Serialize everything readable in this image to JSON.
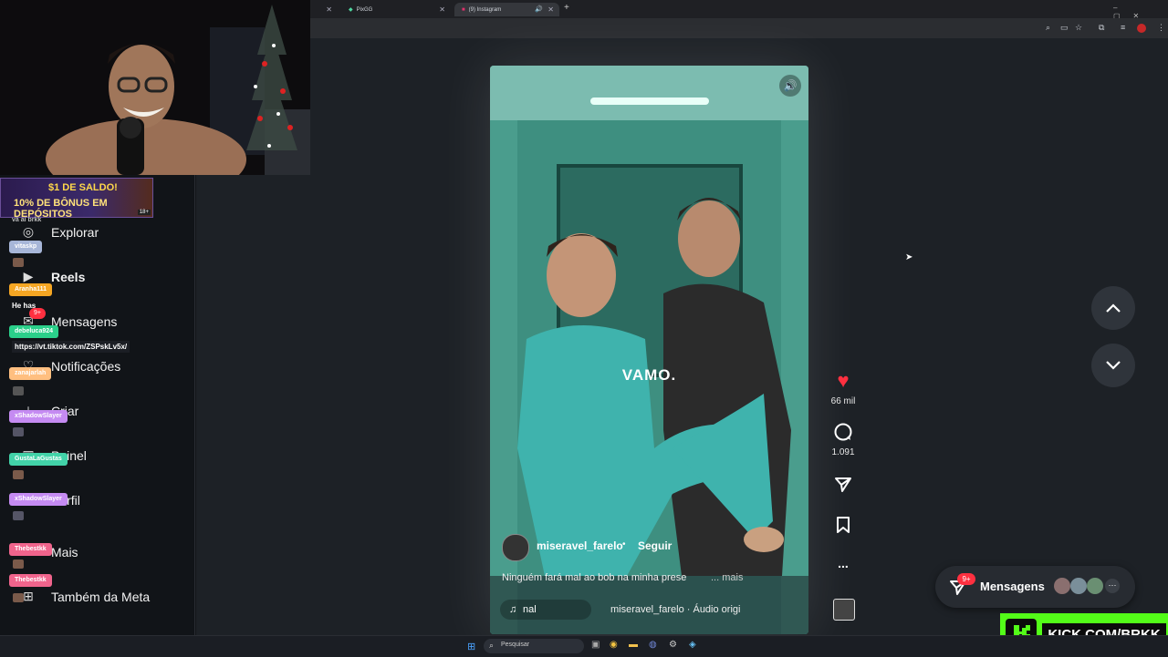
{
  "browser": {
    "tabs": [
      {
        "label": "PixGG"
      },
      {
        "label": "(9) Instagram"
      }
    ],
    "new_tab_symbol": "+"
  },
  "stream_overlay": {
    "banner": {
      "line1": "$1 DE SALDO!",
      "line2": "10% DE BÔNUS EM DEPÓSITOS",
      "badge": "18+"
    },
    "chat": [
      {
        "user": "vá aí brkk",
        "color": "#1b1e24"
      },
      {
        "user": "vitaskp",
        "color": "#a7b6d8"
      },
      {
        "user": "Aranha111",
        "color": "#f5a623"
      },
      {
        "user": "He has",
        "color": "transparent"
      },
      {
        "user": "debeluca924",
        "color": "#2bd08a"
      },
      {
        "user": "https://vt.tiktok.com/ZSPskLv5x/",
        "color": "#1b1e24"
      },
      {
        "user": "zanajarlah",
        "color": "#ffbf80"
      },
      {
        "user": "xShadowSlayer",
        "color": "#c58bf2"
      },
      {
        "user": "GustaLaGustas",
        "color": "#42d2a8"
      },
      {
        "user": "xShadowSlayer",
        "color": "#c58bf2"
      },
      {
        "user": "Thebestkk",
        "color": "#f0648c"
      },
      {
        "user": "Thebestkk",
        "color": "#f0648c"
      }
    ]
  },
  "sidebar": {
    "items": [
      {
        "label": "Explorar",
        "icon": "compass-icon"
      },
      {
        "label": "Reels",
        "icon": "reels-icon"
      },
      {
        "label": "Mensagens",
        "icon": "messenger-icon",
        "badge": "9+"
      },
      {
        "label": "Notificações",
        "icon": "heart-icon"
      },
      {
        "label": "Criar",
        "icon": "plus-icon"
      },
      {
        "label": "Painel",
        "icon": "dashboard-icon"
      },
      {
        "label": "Perfil",
        "icon": "profile-icon"
      },
      {
        "label": "Mais",
        "icon": "menu-icon"
      },
      {
        "label": "Também da Meta",
        "icon": "meta-icon"
      }
    ]
  },
  "reel": {
    "overlay_text": "VAMO.",
    "username": "miseravel_farelo",
    "separator": "•",
    "follow_label": "Seguir",
    "caption": "Ninguém fará mal ao bob na minha prese",
    "caption_more": "... mais",
    "audio_left": "nal",
    "audio": "miseravel_farelo · Áudio origi"
  },
  "actions": {
    "likes": "66 mil",
    "comments": "1.091",
    "more_symbol": "..."
  },
  "messages_pill": {
    "label": "Mensagens",
    "badge": "9+",
    "more_symbol": "···"
  },
  "kick": {
    "text": "KICK.COM/BRKK"
  },
  "taskbar": {
    "search_placeholder": "Pesquisar"
  },
  "colors": {
    "like_red": "#ff3040",
    "kick_green": "#53fc18",
    "instagram_bg": "#1d2126"
  }
}
